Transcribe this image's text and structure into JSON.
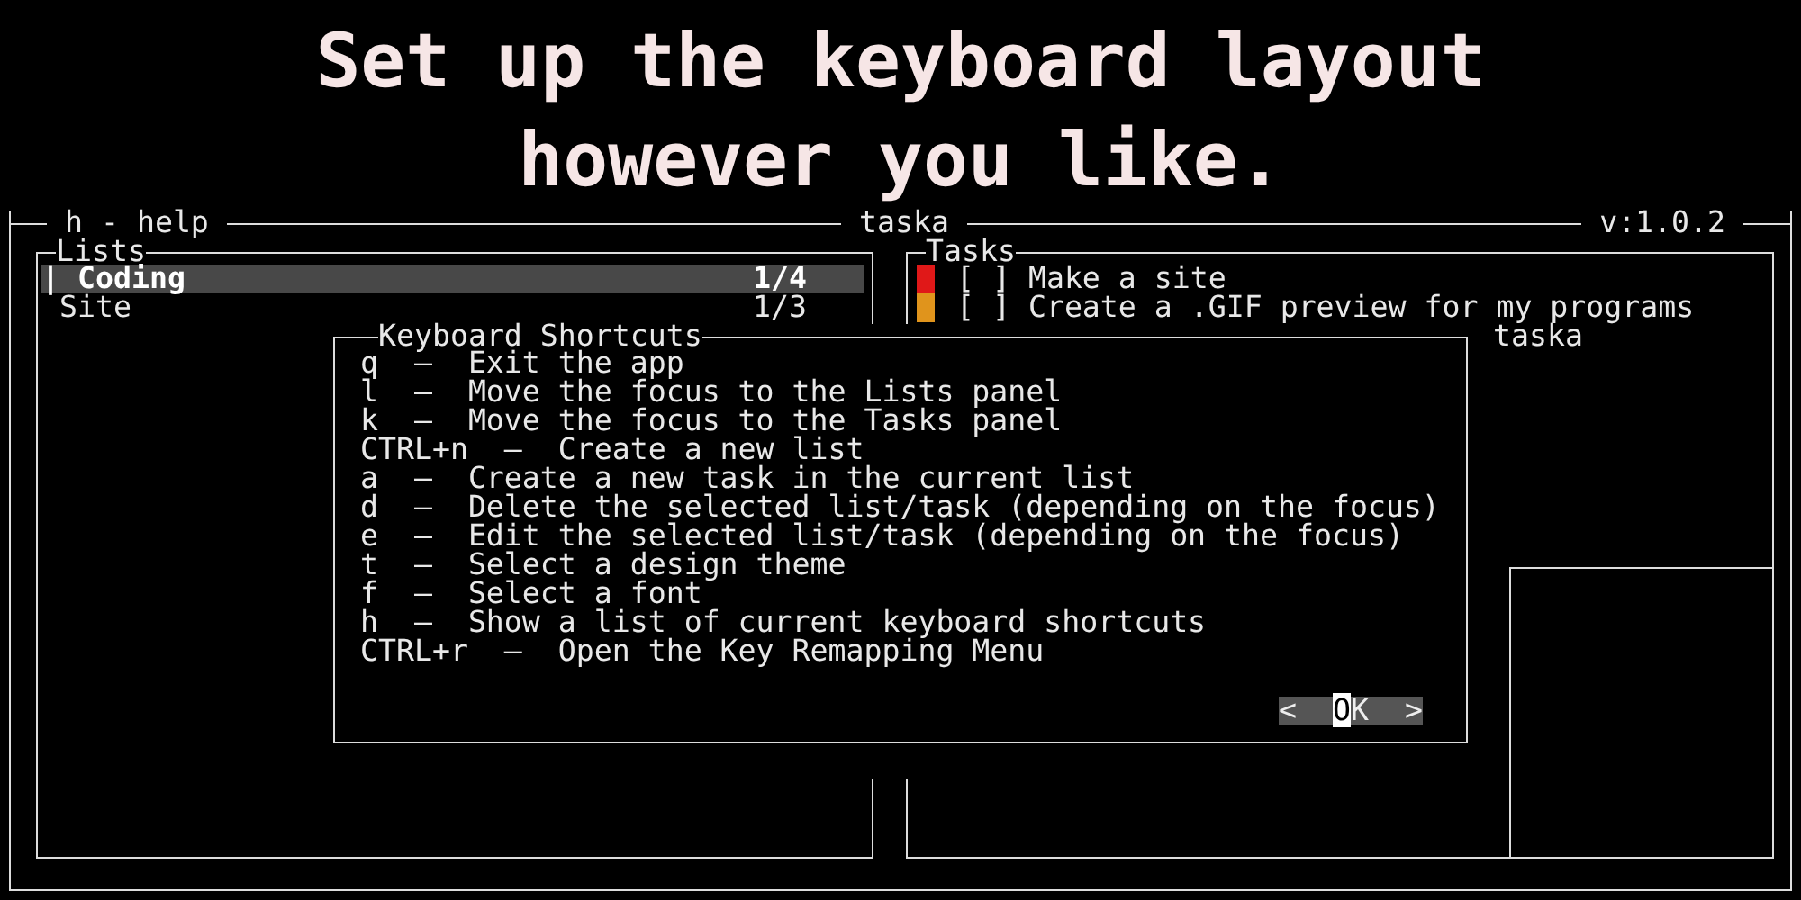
{
  "headline": [
    "Set up the keyboard layout",
    "however you like."
  ],
  "frame": {
    "help_hint": "h - help",
    "title": "taska",
    "version": "v:1.0.2"
  },
  "lists": {
    "title": "Lists",
    "marker": "|",
    "items": [
      {
        "name": "Coding",
        "count": "1/4",
        "selected": true
      },
      {
        "name": "Site",
        "count": "1/3",
        "selected": false
      }
    ]
  },
  "tasks": {
    "title": "Tasks",
    "items": [
      {
        "color": "#e01818",
        "checkbox": "[ ]",
        "text": "Make a site"
      },
      {
        "color": "#e0941c",
        "checkbox": "[ ]",
        "text": "Create a .GIF preview for my programs"
      }
    ],
    "detail_title": "taska"
  },
  "dialog": {
    "title": "Keyboard Shortcuts",
    "shortcuts": [
      "q  —  Exit the app",
      "l  —  Move the focus to the Lists panel",
      "k  —  Move the focus to the Tasks panel",
      "CTRL+n  —  Create a new list",
      "a  —  Create a new task in the current list",
      "d  —  Delete the selected list/task (depending on the focus)",
      "e  —  Edit the selected list/task (depending on the focus)",
      "t  —  Select a design theme",
      "f  —  Select a font",
      "h  —  Show a list of current keyboard shortcuts",
      "CTRL+r  —  Open the Key Remapping Menu"
    ],
    "button": {
      "left": "<",
      "label": "OK",
      "right": ">"
    }
  }
}
